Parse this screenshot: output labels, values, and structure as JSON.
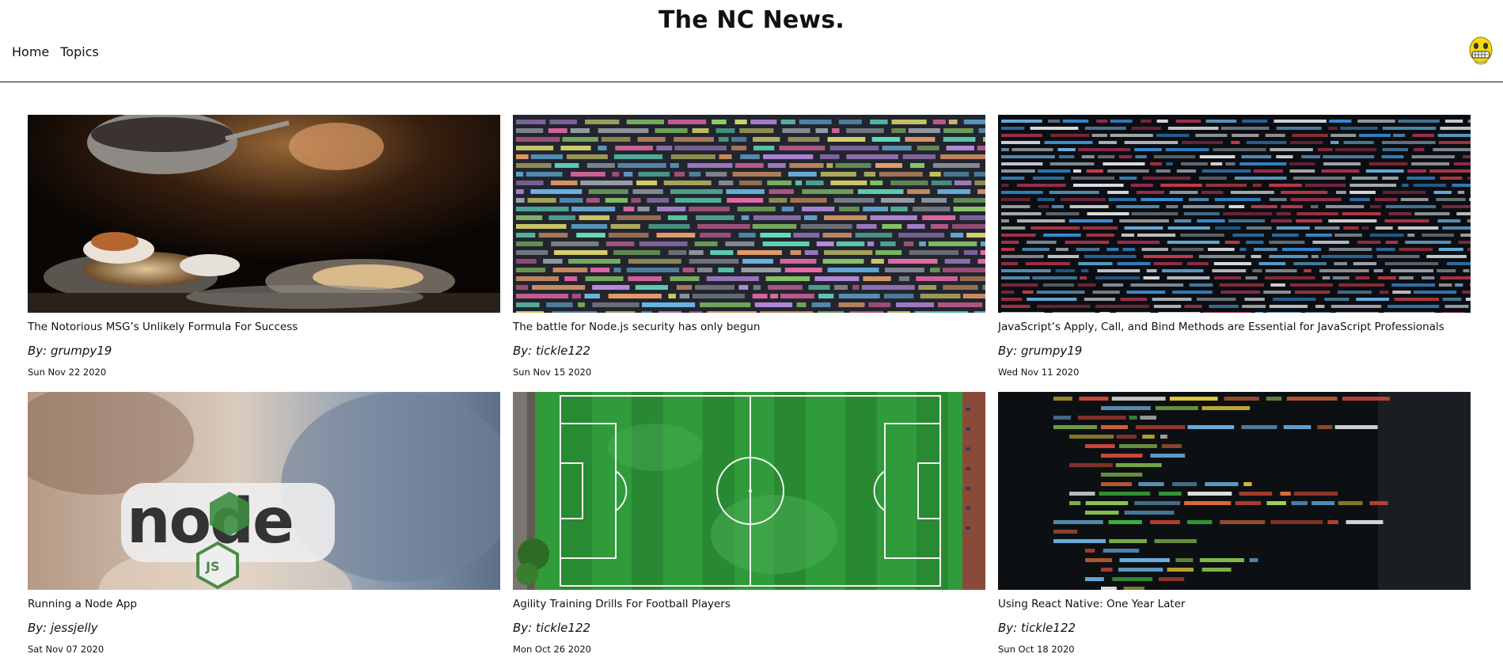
{
  "header": {
    "title": "The NC News.",
    "nav": [
      {
        "label": "Home"
      },
      {
        "label": "Topics"
      }
    ],
    "avatar_icon": "grinning-face-avatar-icon"
  },
  "articles": [
    {
      "title": "The Notorious MSG’s Unlikely Formula For Success",
      "by_prefix": "By:",
      "author": "grumpy19",
      "date": "Sun Nov 22 2020",
      "image": "cooking-pan-food-photo"
    },
    {
      "title": "The battle for Node.js security has only begun",
      "by_prefix": "By:",
      "author": "tickle122",
      "date": "Sun Nov 15 2020",
      "image": "colorful-code-screen-photo"
    },
    {
      "title": "JavaScript’s Apply, Call, and Bind Methods are Essential for JavaScript Professionals",
      "by_prefix": "By:",
      "author": "grumpy19",
      "date": "Wed Nov 11 2020",
      "image": "dark-code-screen-photo"
    },
    {
      "title": "Running a Node App",
      "by_prefix": "By:",
      "author": "jessjelly",
      "date": "Sat Nov 07 2020",
      "image": "node-sticker-photo"
    },
    {
      "title": "Agility Training Drills For Football Players",
      "by_prefix": "By:",
      "author": "tickle122",
      "date": "Mon Oct 26 2020",
      "image": "football-pitch-aerial-photo"
    },
    {
      "title": "Using React Native: One Year Later",
      "by_prefix": "By:",
      "author": "tickle122",
      "date": "Sun Oct 18 2020",
      "image": "python-code-screen-photo"
    }
  ],
  "image_text": {
    "node_logo": "node",
    "js_badge": "JS"
  },
  "colors": {
    "text": "#111111",
    "avatar_yellow": "#f5d90a",
    "pitch_green": "#2f9b3a"
  }
}
